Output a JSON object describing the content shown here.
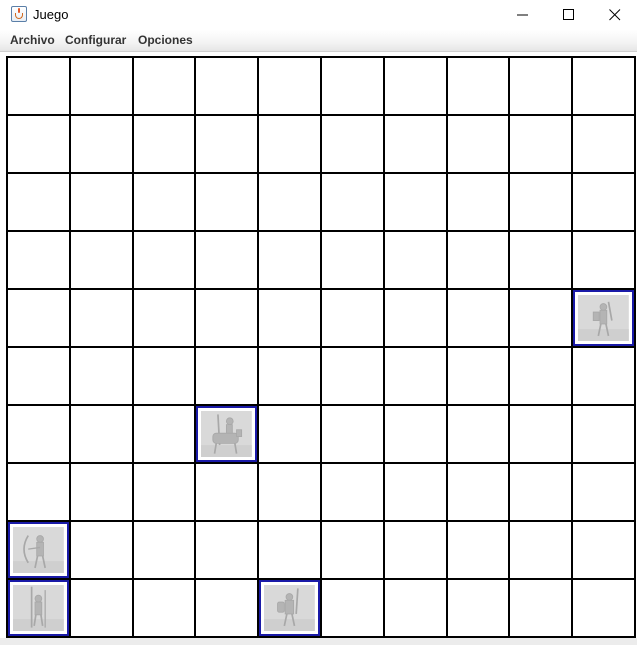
{
  "window": {
    "title": "Juego",
    "icon": "java-cup-icon",
    "controls": [
      "minimize-icon",
      "maximize-icon",
      "close-icon"
    ]
  },
  "menu": {
    "items": [
      {
        "label": "Archivo"
      },
      {
        "label": "Configurar"
      },
      {
        "label": "Opciones"
      }
    ]
  },
  "board": {
    "rows": 10,
    "cols": 10,
    "highlight_color": "#1a1aa8",
    "units": [
      {
        "row": 4,
        "col": 9,
        "kind": "swordsman"
      },
      {
        "row": 6,
        "col": 3,
        "kind": "cavalry"
      },
      {
        "row": 8,
        "col": 0,
        "kind": "archer"
      },
      {
        "row": 9,
        "col": 0,
        "kind": "pikeman"
      },
      {
        "row": 9,
        "col": 4,
        "kind": "knight"
      }
    ]
  }
}
